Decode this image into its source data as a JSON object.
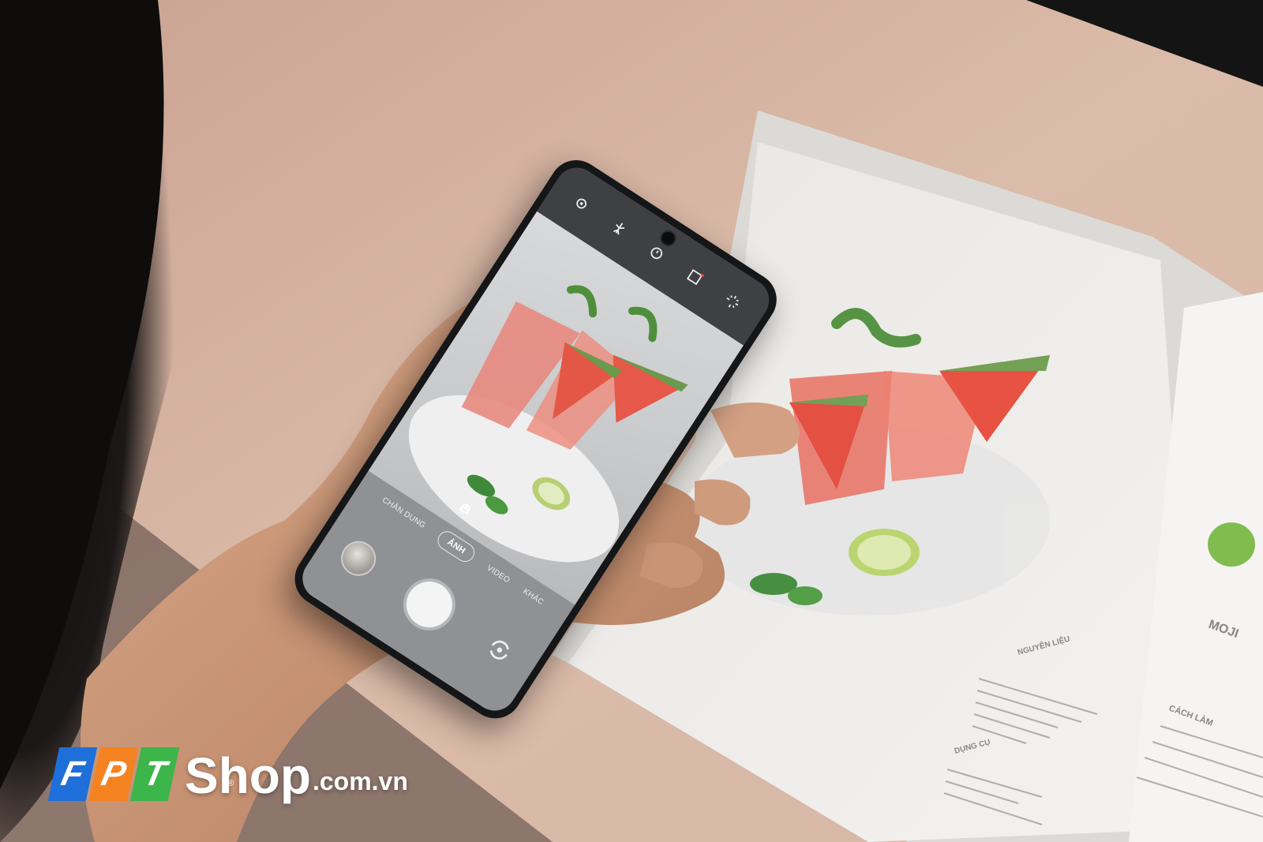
{
  "camera_app": {
    "modes": [
      "CHÂN DUNG",
      "ẢNH",
      "VIDEO",
      "KHÁC"
    ],
    "active_mode": "ẢNH",
    "top_icons": [
      "settings-icon",
      "motion-photo-icon",
      "timer-off-icon",
      "aspect-ratio-icon",
      "filter-icon"
    ],
    "timer_badge": "OFF"
  },
  "watermark": {
    "brand_letters": [
      "F",
      "P",
      "T"
    ],
    "brand_colors": [
      "#1e6fd9",
      "#f58220",
      "#3cb54a"
    ],
    "registered_mark": "®",
    "name": "Shop",
    "domain": ".com.vn"
  },
  "book": {
    "heading": "MOJI",
    "section_ingredients": "NGUYÊN LIỆU",
    "section_tools": "DỤNG CỤ",
    "section_method": "CÁCH LÀM"
  }
}
